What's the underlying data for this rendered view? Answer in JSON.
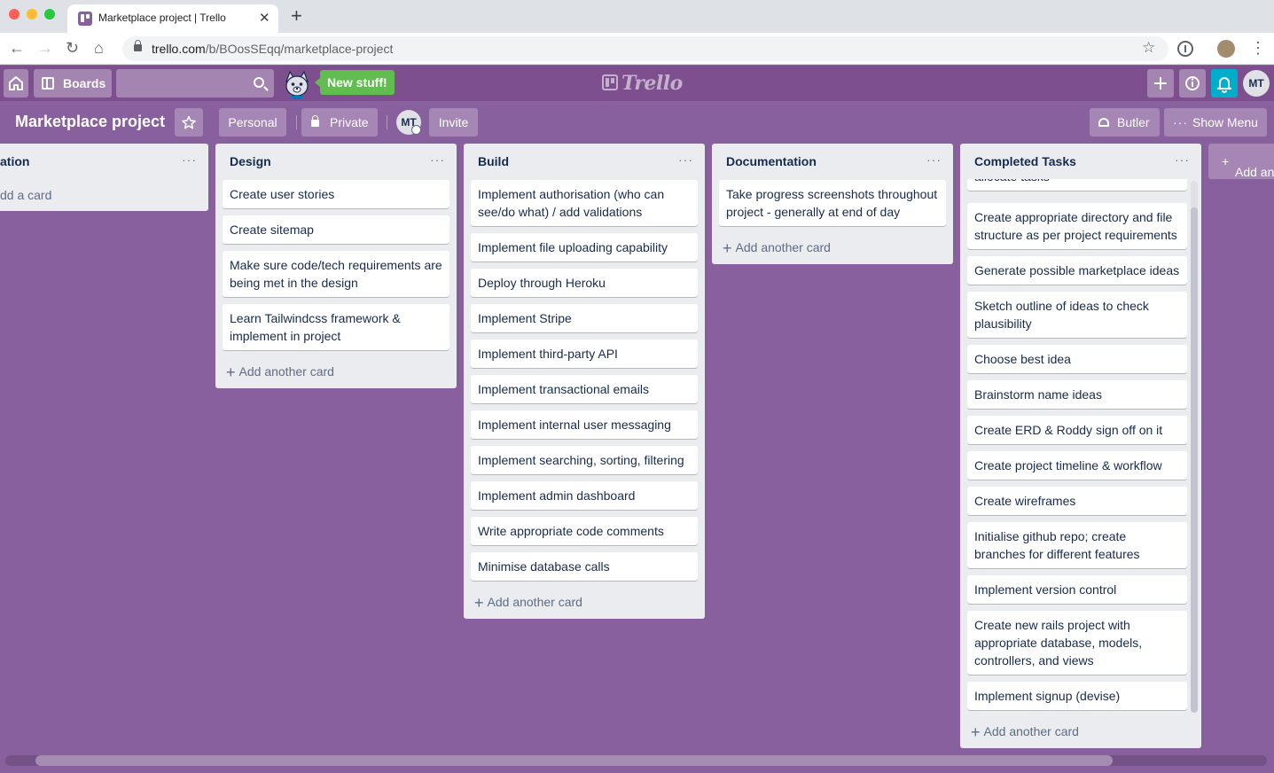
{
  "browser": {
    "tab_title": "Marketplace project | Trello",
    "url_host": "trello.com",
    "url_path": "/b/BOosSEqq/marketplace-project"
  },
  "header": {
    "boards_label": "Boards",
    "search_value": "",
    "new_stuff_label": "New stuff!",
    "logo_text": "Trello",
    "avatar_initials": "MT",
    "bell_color": "#00aecc"
  },
  "board": {
    "title": "Marketplace project",
    "visibility_team": "Personal",
    "visibility": "Private",
    "member_initials": "MT",
    "invite_label": "Invite",
    "butler_label": "Butler",
    "show_menu_label": "Show Menu",
    "background_color": "#89609e",
    "add_list_label": "Add another list"
  },
  "lists": [
    {
      "title": "Implementation",
      "title_visible": "ation",
      "add_label": "Add a card",
      "add_label_visible": "dd a card",
      "cards": []
    },
    {
      "title": "Design",
      "add_label": "Add another card",
      "cards": [
        "Create user stories",
        "Create sitemap",
        "Make sure code/tech requirements are being met in the design",
        "Learn Tailwindcss framework & implement in project"
      ]
    },
    {
      "title": "Build",
      "add_label": "Add another card",
      "cards": [
        "Implement authorisation (who can see/do what) / add validations",
        "Implement file uploading capability",
        "Deploy through Heroku",
        "Implement Stripe",
        "Implement third-party API",
        "Implement transactional emails",
        "Implement internal user messaging",
        "Implement searching, sorting, filtering",
        "Implement admin dashboard",
        "Write appropriate code comments",
        "Minimise database calls"
      ]
    },
    {
      "title": "Documentation",
      "add_label": "Add another card",
      "cards": [
        "Take progress screenshots throughout project - generally at end of day"
      ]
    },
    {
      "title": "Completed Tasks",
      "add_label": "Add another card",
      "cards": [
        "allocate tasks",
        "Create appropriate directory and file structure as per project requirements",
        "Generate possible marketplace ideas",
        "Sketch outline of ideas to check plausibility",
        "Choose best idea",
        "Brainstorm name ideas",
        "Create ERD & Roddy sign off on it",
        "Create project timeline & workflow",
        "Create wireframes",
        "Initialise github repo; create branches for different features",
        "Implement version control",
        "Create new rails project with appropriate database, models, controllers, and views",
        "Implement signup (devise)"
      ]
    }
  ]
}
